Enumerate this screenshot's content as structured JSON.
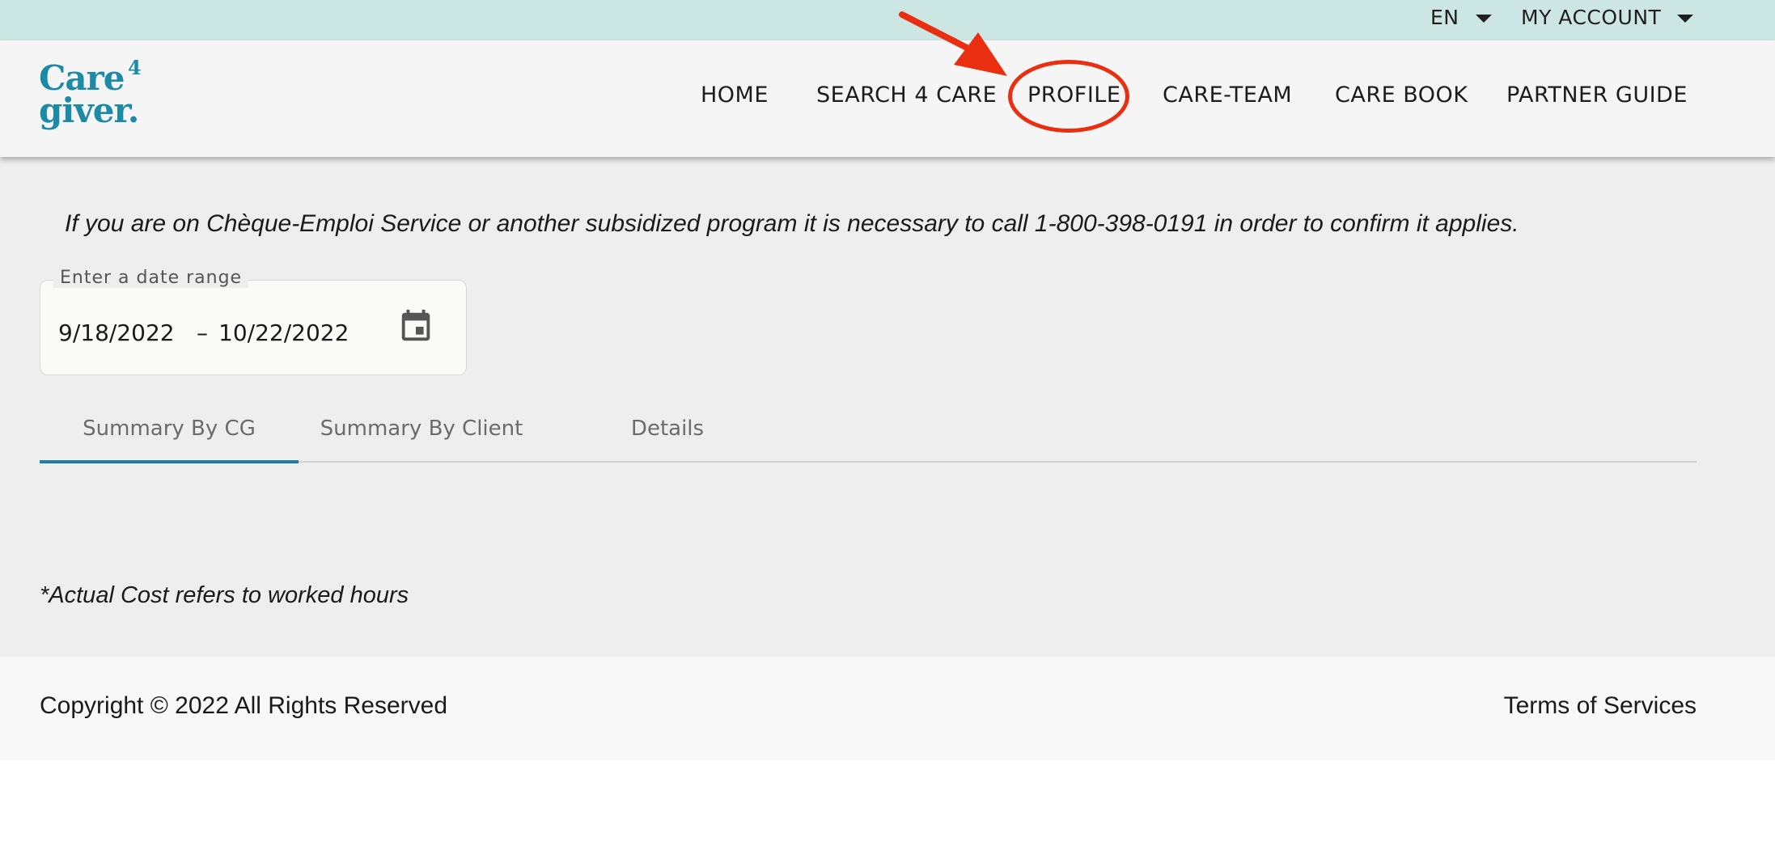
{
  "utility_bar": {
    "language": "EN",
    "account": "MY ACCOUNT"
  },
  "brand": {
    "logo_line1": "Care",
    "logo_sup": "4",
    "logo_line2": "giver.",
    "logo_color": "#1d8aa6"
  },
  "nav": {
    "items": [
      {
        "label": "HOME"
      },
      {
        "label": "SEARCH 4 CARE"
      },
      {
        "label": "PROFILE"
      },
      {
        "label": "CARE-TEAM"
      },
      {
        "label": "CARE BOOK"
      },
      {
        "label": "PARTNER GUIDE"
      }
    ]
  },
  "annotation": {
    "color": "#ea2e10",
    "target": "PROFILE"
  },
  "main": {
    "notice": "If you are on Chèque-Emploi Service or another subsidized program it is necessary to call 1-800-398-0191 in order to confirm it applies.",
    "date_range": {
      "label": "Enter a date range",
      "start": "9/18/2022",
      "separator": "–",
      "end": "10/22/2022",
      "icon": "calendar-icon"
    },
    "tabs": [
      {
        "label": "Summary By CG",
        "active": true
      },
      {
        "label": "Summary By Client",
        "active": false
      },
      {
        "label": "Details",
        "active": false
      }
    ],
    "active_tab_color": "#1d7fa6",
    "footnote": "*Actual Cost refers to worked hours"
  },
  "footer": {
    "copyright": "Copyright © 2022 All Rights Reserved",
    "terms": "Terms of Services"
  }
}
